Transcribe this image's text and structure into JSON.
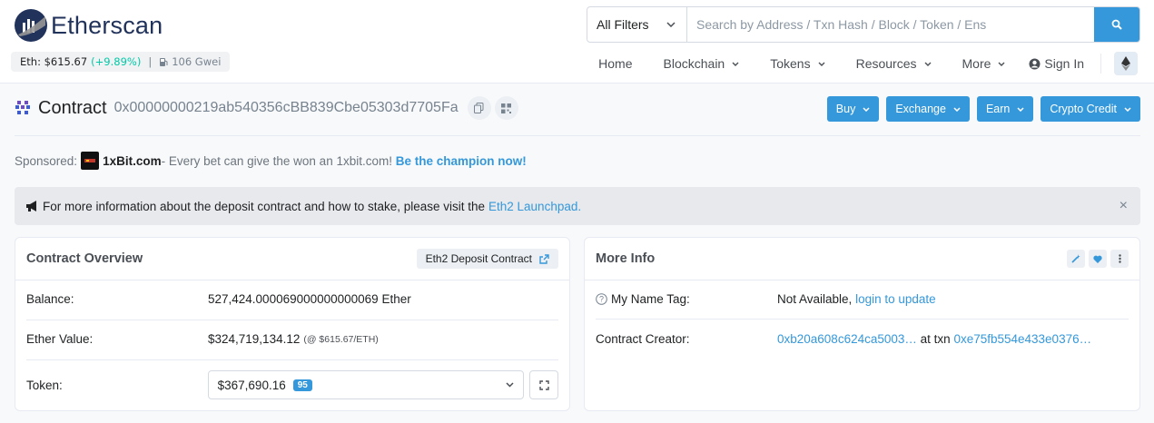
{
  "header": {
    "brand": "Etherscan",
    "price_label": "Eth:",
    "price_value": "$615.67",
    "price_change": "(+9.89%)",
    "gas": "106 Gwei",
    "search": {
      "filter_label": "All Filters",
      "placeholder": "Search by Address / Txn Hash / Block / Token / Ens"
    },
    "nav": {
      "home": "Home",
      "blockchain": "Blockchain",
      "tokens": "Tokens",
      "resources": "Resources",
      "more": "More",
      "signin": "Sign In"
    }
  },
  "title": {
    "label": "Contract",
    "address": "0x00000000219ab540356cBB839Cbe05303d7705Fa",
    "actions": [
      "Buy",
      "Exchange",
      "Earn",
      "Crypto Credit"
    ]
  },
  "sponsor": {
    "prefix": "Sponsored:",
    "name": "1xBit.com",
    "text": " - Every bet can give the won an 1xbit.com!",
    "cta": "Be the champion now!"
  },
  "alert": {
    "text": "For more information about the deposit contract and how to stake, please visit the",
    "link": "Eth2 Launchpad."
  },
  "overview": {
    "title": "Contract Overview",
    "tag": "Eth2 Deposit Contract",
    "balance_label": "Balance:",
    "balance_value": "527,424.000069000000000069 Ether",
    "ether_value_label": "Ether Value:",
    "ether_value": "$324,719,134.12",
    "ether_value_sub": "(@ $615.67/ETH)",
    "token_label": "Token:",
    "token_value": "$367,690.16",
    "token_count": "95"
  },
  "more_info": {
    "title": "More Info",
    "name_tag_label": "My Name Tag:",
    "name_tag_value": "Not Available,",
    "name_tag_link": "login to update",
    "creator_label": "Contract Creator:",
    "creator_address": "0xb20a608c624ca5003…",
    "creator_at": "at txn",
    "creator_txn": "0xe75fb554e433e0376…"
  },
  "colors": {
    "accent": "#3498db",
    "brand": "#21325b",
    "positive": "#00c9a7"
  }
}
